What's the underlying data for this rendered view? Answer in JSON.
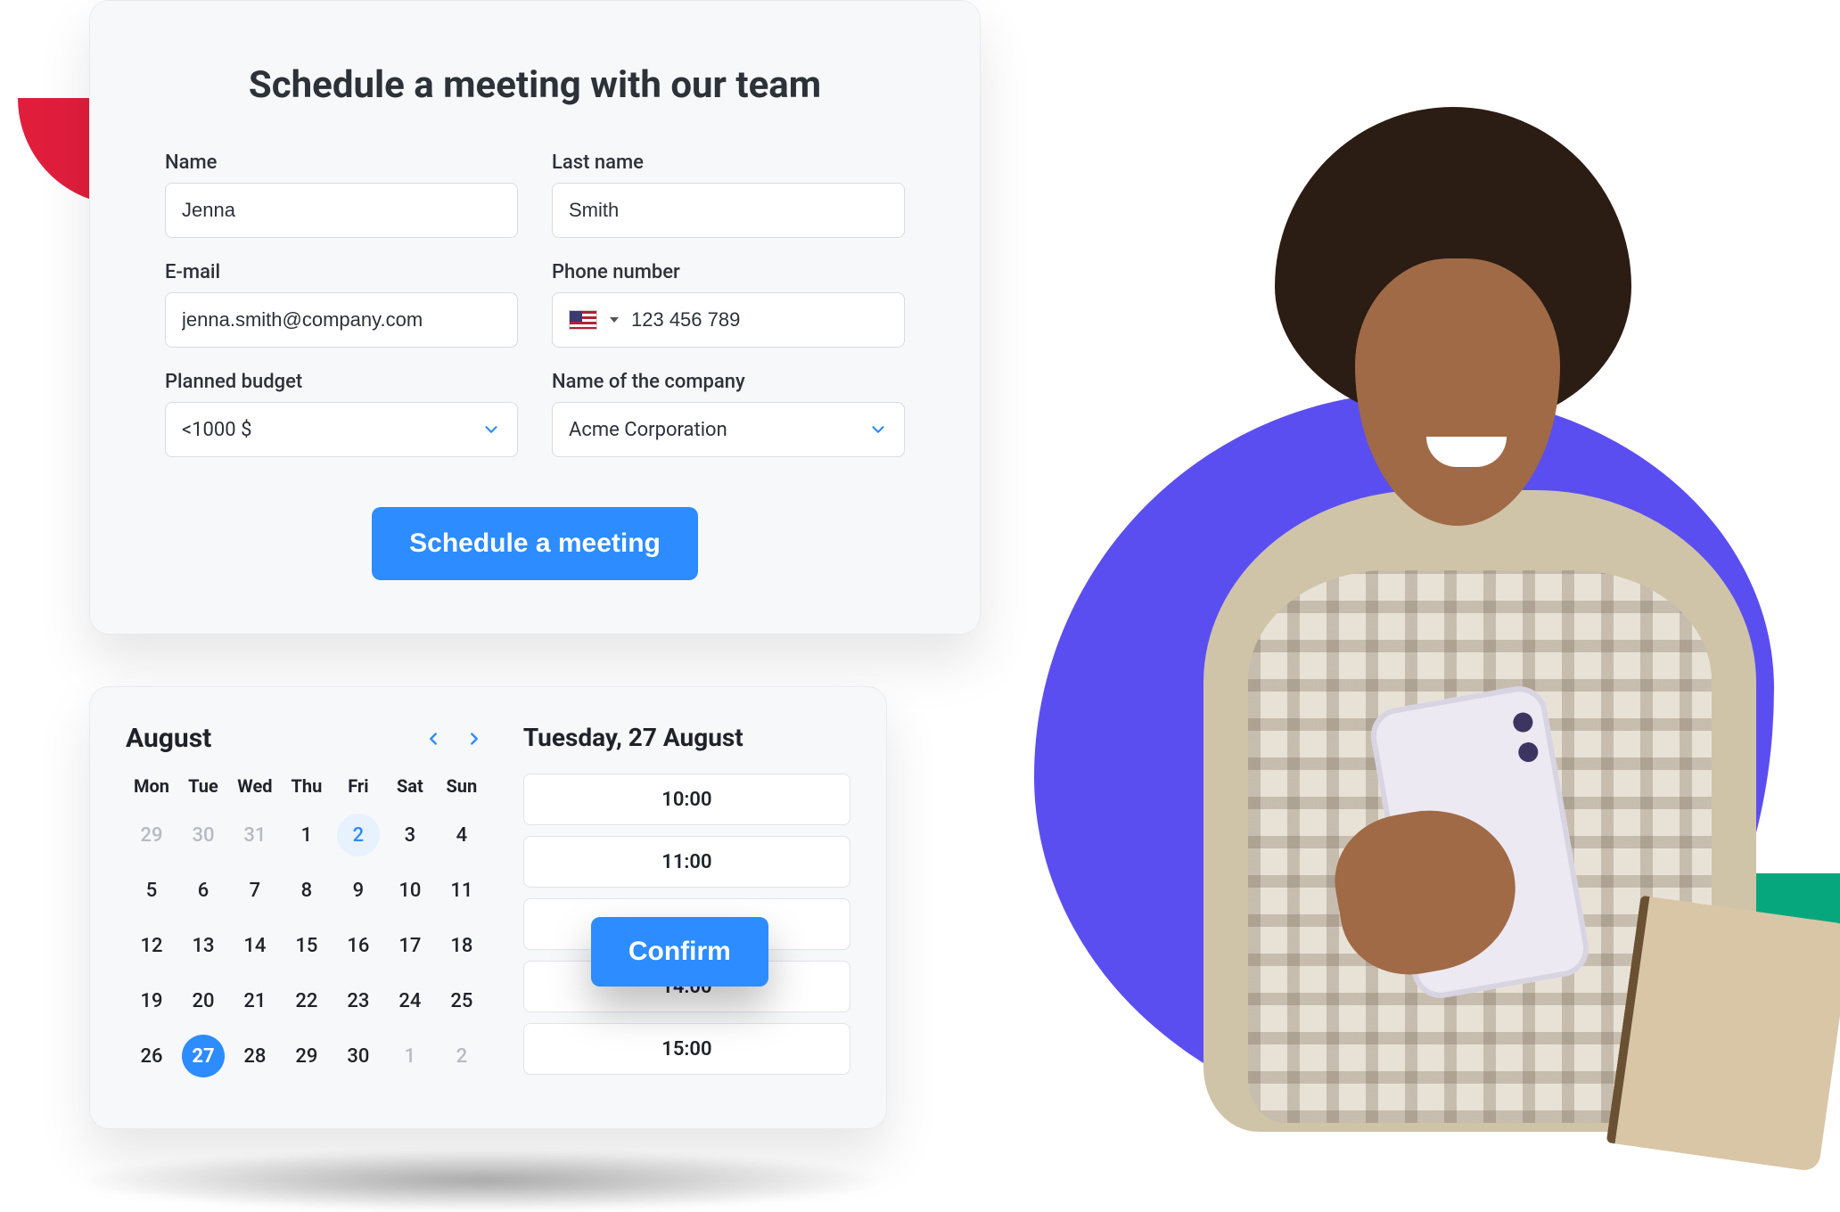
{
  "colors": {
    "primary": "#2d8cff",
    "accent_red": "#e01e3c",
    "accent_purple": "#5b4ef0",
    "accent_green": "#06a77d"
  },
  "form": {
    "title": "Schedule a meeting with our team",
    "fields": {
      "name": {
        "label": "Name",
        "value": "Jenna"
      },
      "last_name": {
        "label": "Last name",
        "value": "Smith"
      },
      "email": {
        "label": "E-mail",
        "value": "jenna.smith@company.com"
      },
      "phone": {
        "label": "Phone number",
        "value": "123 456 789",
        "country_flag": "us"
      },
      "budget": {
        "label": "Planned budget",
        "value": "<1000 $"
      },
      "company": {
        "label": "Name of the company",
        "value": "Acme Corporation"
      }
    },
    "submit_label": "Schedule a meeting"
  },
  "calendar": {
    "month_label": "August",
    "dow": [
      "Mon",
      "Tue",
      "Wed",
      "Thu",
      "Fri",
      "Sat",
      "Sun"
    ],
    "weeks": [
      [
        {
          "n": "29",
          "muted": true
        },
        {
          "n": "30",
          "muted": true
        },
        {
          "n": "31",
          "muted": true
        },
        {
          "n": "1"
        },
        {
          "n": "2",
          "highlight": true
        },
        {
          "n": "3"
        },
        {
          "n": "4"
        }
      ],
      [
        {
          "n": "5"
        },
        {
          "n": "6"
        },
        {
          "n": "7"
        },
        {
          "n": "8"
        },
        {
          "n": "9"
        },
        {
          "n": "10"
        },
        {
          "n": "11"
        }
      ],
      [
        {
          "n": "12"
        },
        {
          "n": "13"
        },
        {
          "n": "14"
        },
        {
          "n": "15"
        },
        {
          "n": "16"
        },
        {
          "n": "17"
        },
        {
          "n": "18"
        }
      ],
      [
        {
          "n": "19"
        },
        {
          "n": "20"
        },
        {
          "n": "21"
        },
        {
          "n": "22"
        },
        {
          "n": "23"
        },
        {
          "n": "24"
        },
        {
          "n": "25"
        }
      ],
      [
        {
          "n": "26"
        },
        {
          "n": "27",
          "selected": true
        },
        {
          "n": "28"
        },
        {
          "n": "29"
        },
        {
          "n": "30"
        },
        {
          "n": "1",
          "muted": true
        },
        {
          "n": "2",
          "muted": true
        }
      ]
    ],
    "picked_date_label": "Tuesday, 27 August",
    "time_slots": [
      "10:00",
      "11:00",
      "",
      "14:00",
      "15:00"
    ],
    "confirm_label": "Confirm"
  }
}
